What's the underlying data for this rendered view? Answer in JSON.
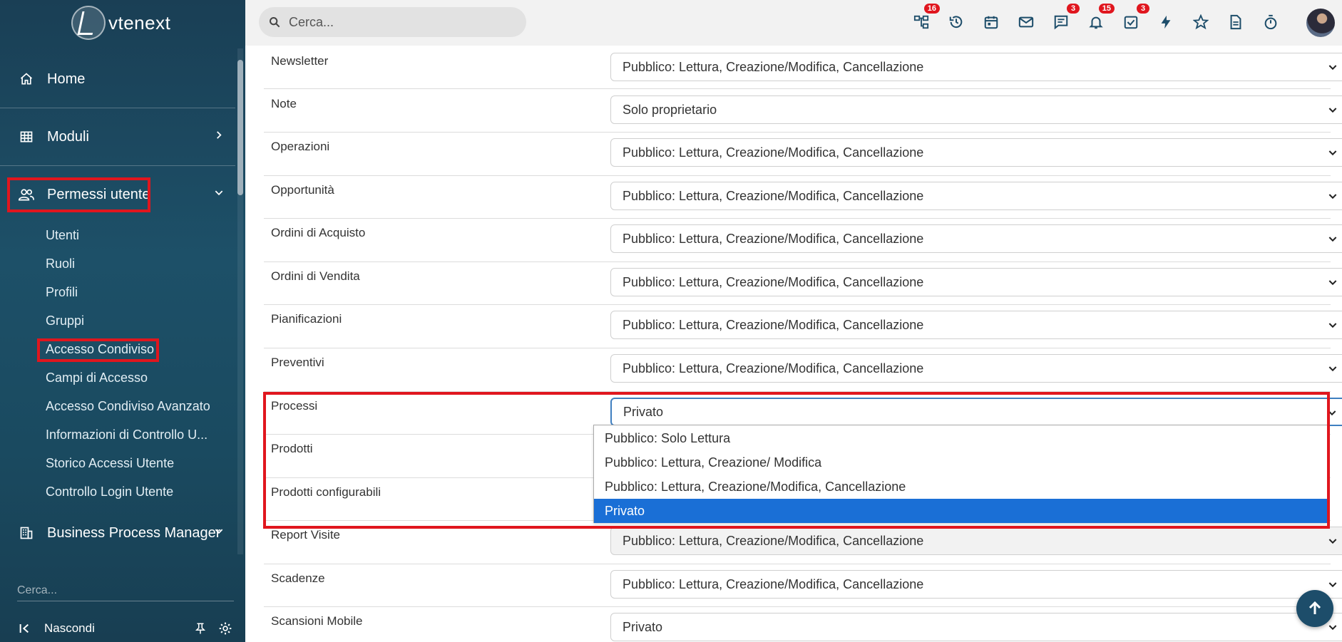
{
  "app": {
    "logo_text": "vtenext"
  },
  "topbar": {
    "search_placeholder": "Cerca...",
    "icons": [
      {
        "name": "processes-icon",
        "badge": "16"
      },
      {
        "name": "history-icon",
        "badge": ""
      },
      {
        "name": "calendar-icon",
        "badge": ""
      },
      {
        "name": "mail-icon",
        "badge": ""
      },
      {
        "name": "chat-icon",
        "badge": "3"
      },
      {
        "name": "bell-icon",
        "badge": "15"
      },
      {
        "name": "tasks-icon",
        "badge": "3"
      },
      {
        "name": "lightning-icon",
        "badge": ""
      },
      {
        "name": "star-icon",
        "badge": ""
      },
      {
        "name": "document-icon",
        "badge": ""
      },
      {
        "name": "timer-icon",
        "badge": ""
      }
    ]
  },
  "sidebar": {
    "home": "Home",
    "moduli": "Moduli",
    "permessi": "Permessi utente",
    "sub_items": [
      "Utenti",
      "Ruoli",
      "Profili",
      "Gruppi",
      "Accesso Condiviso",
      "Campi di Accesso",
      "Accesso Condiviso Avanzato",
      "Informazioni di Controllo U...",
      "Storico Accessi Utente",
      "Controllo Login Utente"
    ],
    "bpm": "Business Process Manager",
    "search_placeholder": "Cerca...",
    "hide_label": "Nascondi"
  },
  "rows": [
    {
      "label": "Newsletter",
      "value": "Pubblico: Lettura, Creazione/Modifica, Cancellazione"
    },
    {
      "label": "Note",
      "value": "Solo proprietario"
    },
    {
      "label": "Operazioni",
      "value": "Pubblico: Lettura, Creazione/Modifica, Cancellazione"
    },
    {
      "label": "Opportunità",
      "value": "Pubblico: Lettura, Creazione/Modifica, Cancellazione"
    },
    {
      "label": "Ordini di Acquisto",
      "value": "Pubblico: Lettura, Creazione/Modifica, Cancellazione"
    },
    {
      "label": "Ordini di Vendita",
      "value": "Pubblico: Lettura, Creazione/Modifica, Cancellazione"
    },
    {
      "label": "Pianificazioni",
      "value": "Pubblico: Lettura, Creazione/Modifica, Cancellazione"
    },
    {
      "label": "Preventivi",
      "value": "Pubblico: Lettura, Creazione/Modifica, Cancellazione"
    },
    {
      "label": "Processi",
      "value": "Privato"
    },
    {
      "label": "Prodotti",
      "value": ""
    },
    {
      "label": "Prodotti configurabili",
      "value": ""
    },
    {
      "label": "Report Visite",
      "value": "Pubblico: Lettura, Creazione/Modifica, Cancellazione"
    },
    {
      "label": "Scadenze",
      "value": "Pubblico: Lettura, Creazione/Modifica, Cancellazione"
    },
    {
      "label": "Scansioni Mobile",
      "value": "Privato"
    }
  ],
  "dropdown": {
    "options": [
      "Pubblico: Solo Lettura",
      "Pubblico: Lettura, Creazione/ Modifica",
      "Pubblico: Lettura, Creazione/Modifica, Cancellazione",
      "Privato"
    ],
    "selected_index": 3
  },
  "colors": {
    "accent": "#1a6fd6",
    "highlight": "#e0161e",
    "sidebar": "#1d5068"
  }
}
